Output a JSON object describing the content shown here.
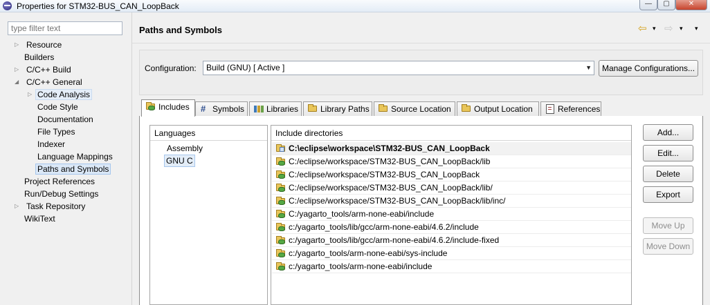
{
  "window": {
    "title": "Properties for STM32-BUS_CAN_LoopBack",
    "min_glyph": "—",
    "max_glyph": "▢",
    "close_glyph": "✕"
  },
  "sidebar": {
    "filter_placeholder": "type filter text",
    "items": [
      {
        "label": "Resource",
        "expandable": true
      },
      {
        "label": "Builders",
        "expandable": false
      },
      {
        "label": "C/C++ Build",
        "expandable": true
      },
      {
        "label": "C/C++ General",
        "expandable": true,
        "expanded": true
      },
      {
        "label": "Code Analysis",
        "expandable": true
      },
      {
        "label": "Code Style",
        "expandable": false
      },
      {
        "label": "Documentation",
        "expandable": false
      },
      {
        "label": "File Types",
        "expandable": false
      },
      {
        "label": "Indexer",
        "expandable": false
      },
      {
        "label": "Language Mappings",
        "expandable": false
      },
      {
        "label": "Paths and Symbols",
        "expandable": false,
        "selected": true
      },
      {
        "label": "Project References",
        "expandable": false
      },
      {
        "label": "Run/Debug Settings",
        "expandable": false
      },
      {
        "label": "Task Repository",
        "expandable": true
      },
      {
        "label": "WikiText",
        "expandable": false
      }
    ]
  },
  "header": {
    "title": "Paths and Symbols",
    "back_glyph": "⇦",
    "forward_glyph": "⇨",
    "menu_glyph": "▾"
  },
  "configuration": {
    "label": "Configuration:",
    "value": "Build (GNU)  [ Active ]",
    "manage_label": "Manage Configurations..."
  },
  "tabs": [
    {
      "label": "Includes",
      "icon": "folder-include-icon",
      "selected": true
    },
    {
      "label": "Symbols",
      "icon": "hash-icon"
    },
    {
      "label": "Libraries",
      "icon": "library-icon"
    },
    {
      "label": "Library Paths",
      "icon": "folder-icon"
    },
    {
      "label": "Source Location",
      "icon": "folder-icon"
    },
    {
      "label": "Output Location",
      "icon": "folder-icon"
    },
    {
      "label": "References",
      "icon": "page-icon"
    }
  ],
  "languages": {
    "header": "Languages",
    "items": [
      "Assembly",
      "GNU C"
    ],
    "selected": "GNU C"
  },
  "includes": {
    "header": "Include directories",
    "rows": [
      {
        "path": "C:\\eclipse\\workspace\\STM32-BUS_CAN_LoopBack",
        "icon": "project-folder-icon"
      },
      {
        "path": "C:/eclipse/workspace/STM32-BUS_CAN_LoopBack/lib",
        "icon": "include-folder-icon"
      },
      {
        "path": "C:/eclipse/workspace/STM32-BUS_CAN_LoopBack",
        "icon": "include-folder-icon"
      },
      {
        "path": "C:/eclipse/workspace/STM32-BUS_CAN_LoopBack/lib/",
        "icon": "include-folder-icon"
      },
      {
        "path": "C:/eclipse/workspace/STM32-BUS_CAN_LoopBack/lib/inc/",
        "icon": "include-folder-icon"
      },
      {
        "path": "C:/yagarto_tools/arm-none-eabi/include",
        "icon": "include-folder-icon"
      },
      {
        "path": "c:/yagarto_tools/lib/gcc/arm-none-eabi/4.6.2/include",
        "icon": "include-folder-icon"
      },
      {
        "path": "c:/yagarto_tools/lib/gcc/arm-none-eabi/4.6.2/include-fixed",
        "icon": "include-folder-icon"
      },
      {
        "path": "c:/yagarto_tools/arm-none-eabi/sys-include",
        "icon": "include-folder-icon"
      },
      {
        "path": "c:/yagarto_tools/arm-none-eabi/include",
        "icon": "include-folder-icon"
      }
    ]
  },
  "buttons": {
    "add": "Add...",
    "edit": "Edit...",
    "delete": "Delete",
    "export": "Export",
    "move_up": "Move Up",
    "move_down": "Move Down"
  }
}
